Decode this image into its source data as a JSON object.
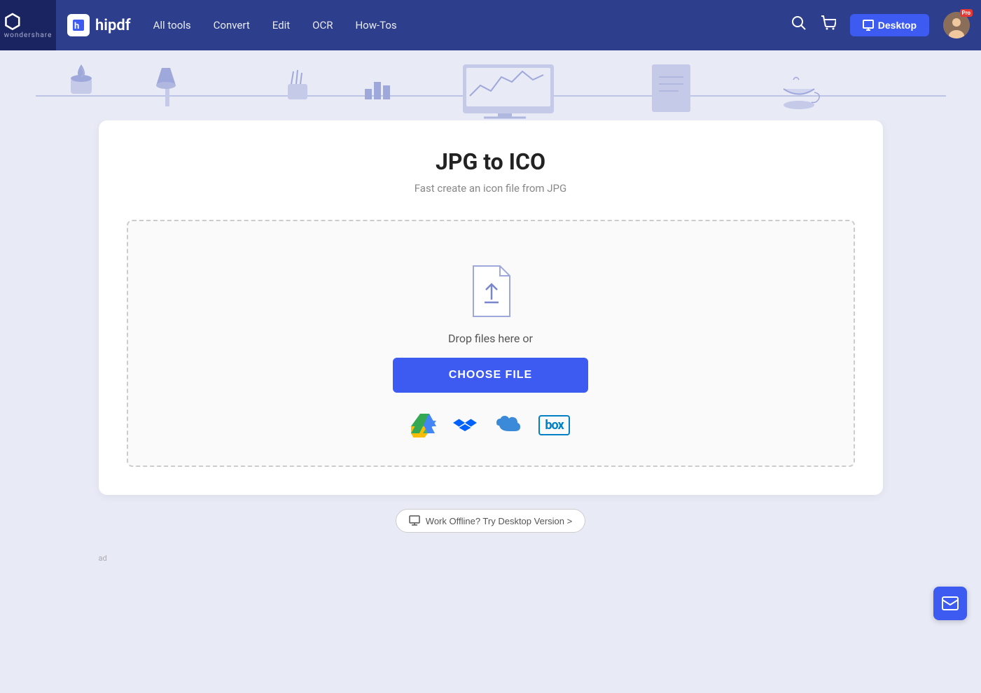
{
  "navbar": {
    "brand": "hipdf",
    "logo_letter": "h",
    "wondershare_text": "wondershare",
    "links": [
      {
        "label": "All tools",
        "id": "all-tools"
      },
      {
        "label": "Convert",
        "id": "convert"
      },
      {
        "label": "Edit",
        "id": "edit"
      },
      {
        "label": "OCR",
        "id": "ocr"
      },
      {
        "label": "How-Tos",
        "id": "how-tos"
      }
    ],
    "desktop_btn": "Desktop",
    "pro_badge": "Pro"
  },
  "converter": {
    "title": "JPG to ICO",
    "subtitle": "Fast create an icon file from JPG",
    "drop_text": "Drop files here or",
    "choose_file_btn": "CHOOSE FILE",
    "offline_text": "Work Offline? Try Desktop Version >"
  },
  "cloud_sources": [
    {
      "id": "google-drive",
      "label": "Google Drive"
    },
    {
      "id": "dropbox",
      "label": "Dropbox"
    },
    {
      "id": "onedrive",
      "label": "OneDrive"
    },
    {
      "id": "box",
      "label": "Box"
    }
  ],
  "ad_label": "ad",
  "float_btn_icon": "✉"
}
